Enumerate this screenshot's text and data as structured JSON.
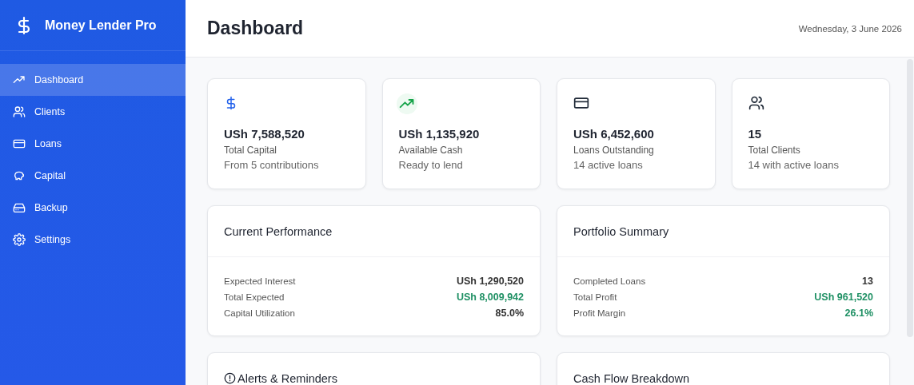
{
  "app": {
    "title": "Money Lender Pro"
  },
  "sidebar": {
    "items": [
      {
        "label": "Dashboard",
        "selected": true
      },
      {
        "label": "Clients",
        "selected": false
      },
      {
        "label": "Loans",
        "selected": false
      },
      {
        "label": "Capital",
        "selected": false
      },
      {
        "label": "Backup",
        "selected": false
      },
      {
        "label": "Settings",
        "selected": false
      }
    ]
  },
  "header": {
    "title": "Dashboard",
    "date": "Wednesday, 3 June 2026"
  },
  "stats": [
    {
      "value": "USh 7,588,520",
      "label": "Total Capital",
      "note": "From 5 contributions"
    },
    {
      "value": "USh 1,135,920",
      "label": "Available Cash",
      "note": "Ready to lend"
    },
    {
      "value": "USh 6,452,600",
      "label": "Loans Outstanding",
      "note": "14 active loans"
    },
    {
      "value": "15",
      "label": "Total Clients",
      "note": "14 with active loans"
    }
  ],
  "panels": [
    {
      "title": "Current Performance",
      "rows": [
        {
          "label": "Expected Interest",
          "value": "USh 1,290,520",
          "positive": false
        },
        {
          "label": "Total Expected",
          "value": "USh 8,009,942",
          "positive": true
        },
        {
          "label": "Capital Utilization",
          "value": "85.0%",
          "positive": false
        }
      ]
    },
    {
      "title": "Portfolio Summary",
      "rows": [
        {
          "label": "Completed Loans",
          "value": "13",
          "positive": false
        },
        {
          "label": "Total Profit",
          "value": "USh 961,520",
          "positive": true
        },
        {
          "label": "Profit Margin",
          "value": "26.1%",
          "positive": true
        }
      ]
    }
  ],
  "lower_panels": [
    {
      "title": "Alerts & Reminders",
      "kind": "alert"
    },
    {
      "title": "Cash Flow Breakdown",
      "kind": "plain"
    }
  ]
}
